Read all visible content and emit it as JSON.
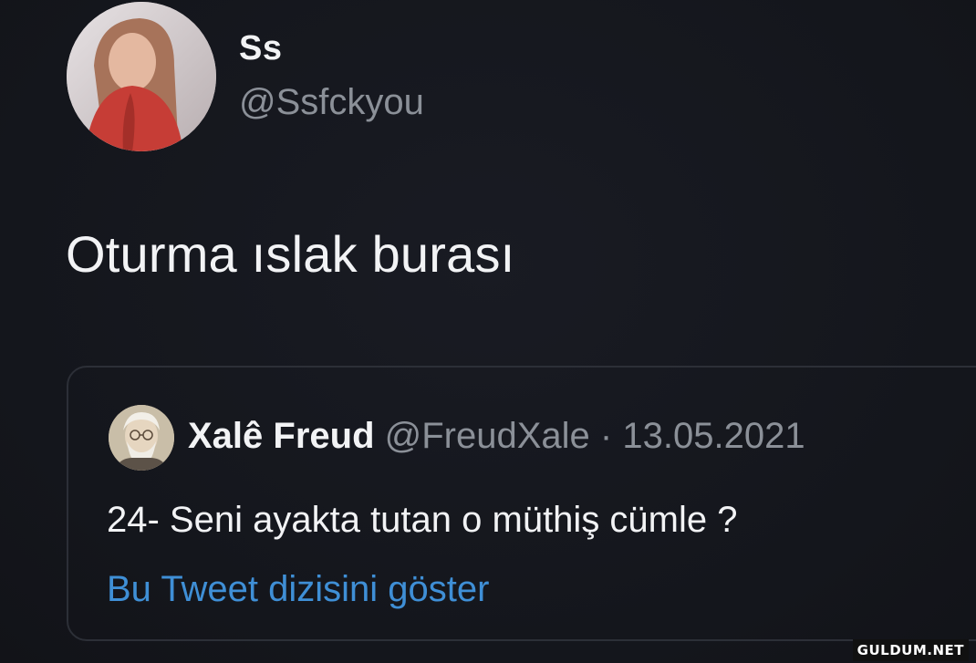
{
  "tweet": {
    "display_name": "Ss",
    "handle": "@Ssfckyou",
    "text": "Oturma ıslak burası",
    "avatar_icon": "profile-photo"
  },
  "quoted_tweet": {
    "display_name": "Xalê Freud",
    "handle": "@FreudXale",
    "separator": "·",
    "date": "13.05.2021",
    "text": "24- Seni ayakta tutan o müthiş cümle ?",
    "show_thread_label": "Bu Tweet dizisini göster",
    "avatar_icon": "profile-photo"
  },
  "watermark": "GULDUM.NET",
  "colors": {
    "background": "#15171e",
    "primary_text": "#f2f3f5",
    "secondary_text": "#8b9098",
    "link": "#3f8fd6",
    "card_border": "#2c2f37"
  }
}
